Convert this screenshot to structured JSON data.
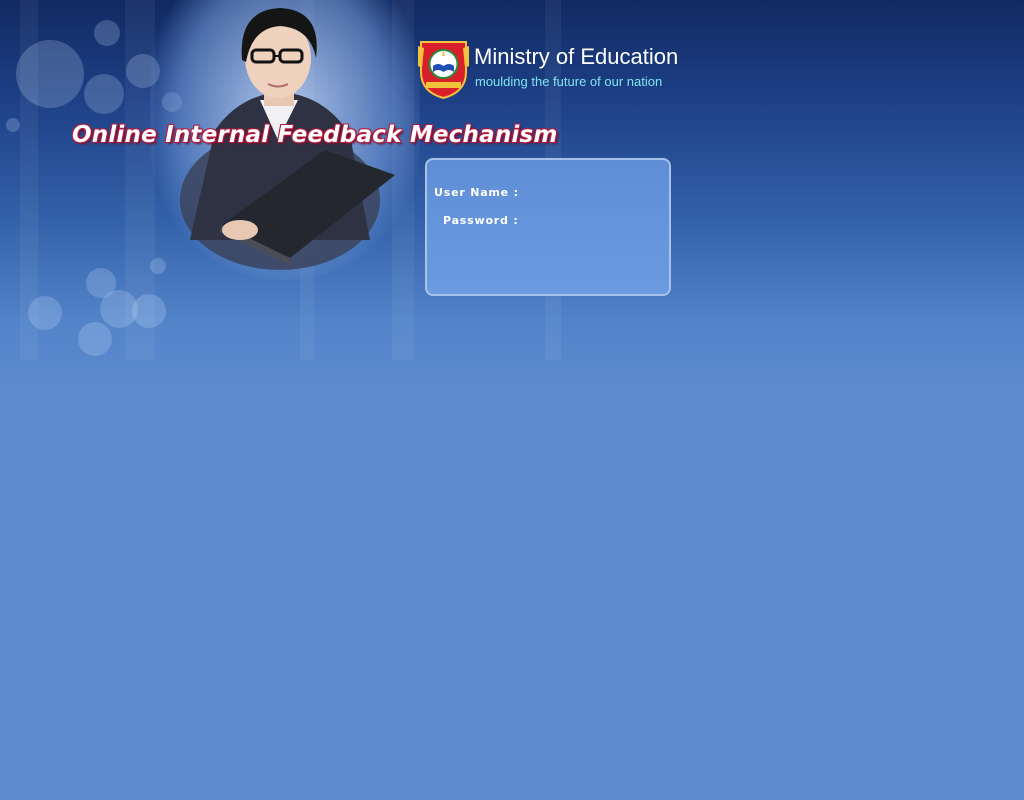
{
  "header": {
    "org_name": "Ministry of Education",
    "tagline": "moulding the future of our nation",
    "logo_icon": "ministry-crest-icon"
  },
  "app": {
    "title": "Online Internal Feedback Mechanism"
  },
  "login": {
    "username_label": "User Name :",
    "username_value": "",
    "password_label": "Password :",
    "password_value": ""
  },
  "colors": {
    "background": "#5e8acf",
    "header_dark": "#112a63",
    "tagline": "#7fe4f2",
    "title_outline": "#b3183c",
    "panel_fill": "#6596dc",
    "panel_border": "#a6c2ea"
  }
}
